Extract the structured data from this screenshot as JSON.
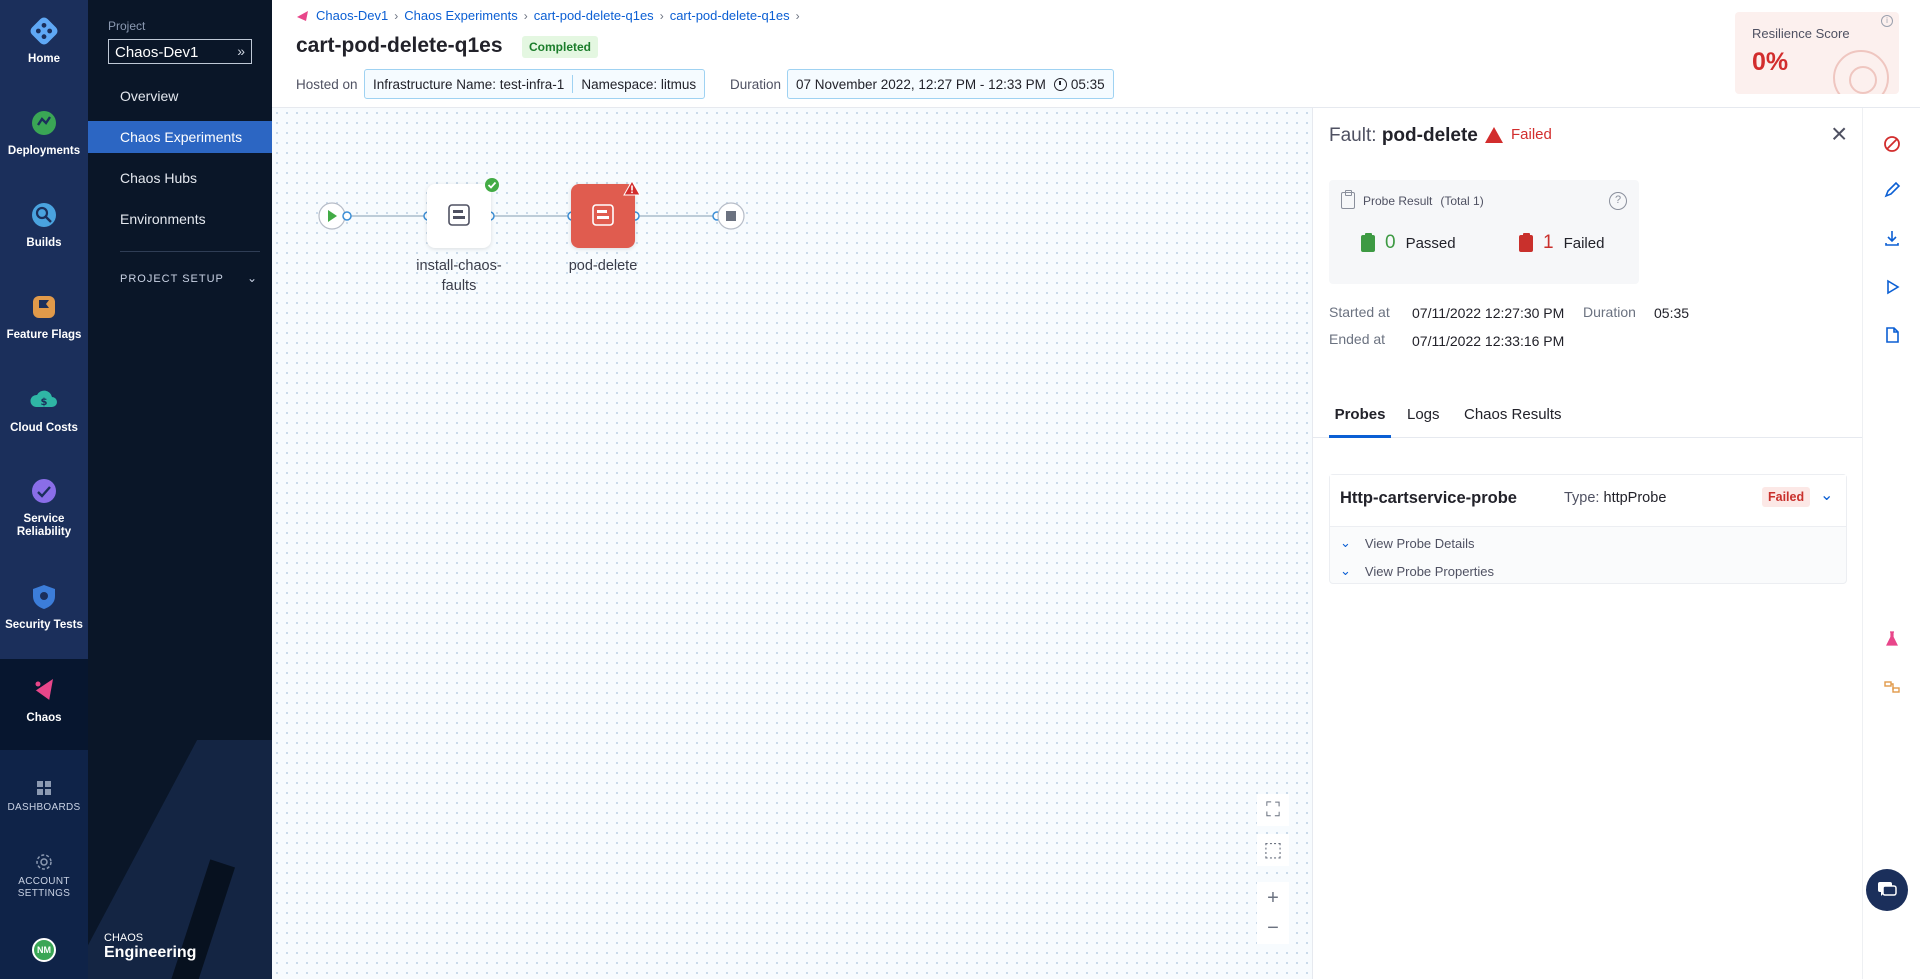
{
  "rail": {
    "items": [
      {
        "label": "Home"
      },
      {
        "label": "Deployments"
      },
      {
        "label": "Builds"
      },
      {
        "label": "Feature Flags"
      },
      {
        "label": "Cloud Costs"
      },
      {
        "label": "Service Reliability"
      },
      {
        "label": "Security Tests"
      },
      {
        "label": "Chaos"
      }
    ],
    "dashboards": "DASHBOARDS",
    "account_settings": "ACCOUNT SETTINGS",
    "avatar": "NM"
  },
  "sidebar": {
    "project_label": "Project",
    "project_name": "Chaos-Dev1",
    "links": [
      {
        "label": "Overview"
      },
      {
        "label": "Chaos Experiments"
      },
      {
        "label": "Chaos Hubs"
      },
      {
        "label": "Environments"
      }
    ],
    "section": "PROJECT SETUP",
    "brand_small": "CHAOS",
    "brand": "Engineering"
  },
  "header": {
    "breadcrumbs": [
      "Chaos-Dev1",
      "Chaos Experiments",
      "cart-pod-delete-q1es",
      "cart-pod-delete-q1es"
    ],
    "title": "cart-pod-delete-q1es",
    "status": "Completed",
    "hosted_label": "Hosted on",
    "infrastructure": "Infrastructure Name: test-infra-1",
    "namespace": "Namespace: litmus",
    "duration_label": "Duration",
    "duration_range": "07 November 2022, 12:27 PM - 12:33 PM",
    "duration_value": "05:35",
    "resilience_label": "Resilience Score",
    "resilience_value": "0%"
  },
  "canvas": {
    "nodes": [
      {
        "label": "install-chaos-faults",
        "status": "success"
      },
      {
        "label": "pod-delete",
        "status": "failed"
      }
    ]
  },
  "panel": {
    "fault_prefix": "Fault:",
    "fault_name": "pod-delete",
    "fault_status": "Failed",
    "probe_result_label": "Probe Result",
    "probe_total": "(Total 1)",
    "passed_count": "0",
    "passed_label": "Passed",
    "failed_count": "1",
    "failed_label": "Failed",
    "started_label": "Started at",
    "started_value": "07/11/2022 12:27:30 PM",
    "duration_label": "Duration",
    "duration_value": "05:35",
    "ended_label": "Ended at",
    "ended_value": "07/11/2022 12:33:16 PM",
    "tabs": [
      {
        "label": "Probes"
      },
      {
        "label": "Logs"
      },
      {
        "label": "Chaos Results"
      }
    ],
    "probe": {
      "name": "Http-cartservice-probe",
      "type_label": "Type:",
      "type_value": "httpProbe",
      "status": "Failed",
      "view_details": "View Probe Details",
      "view_properties": "View Probe Properties"
    }
  },
  "colors": {
    "rail_bg": "#1b2f5b",
    "sidebar_bg": "#0a1628",
    "accent": "#0b5fd4",
    "failed": "#d22d2d",
    "success": "#3d9a43"
  }
}
